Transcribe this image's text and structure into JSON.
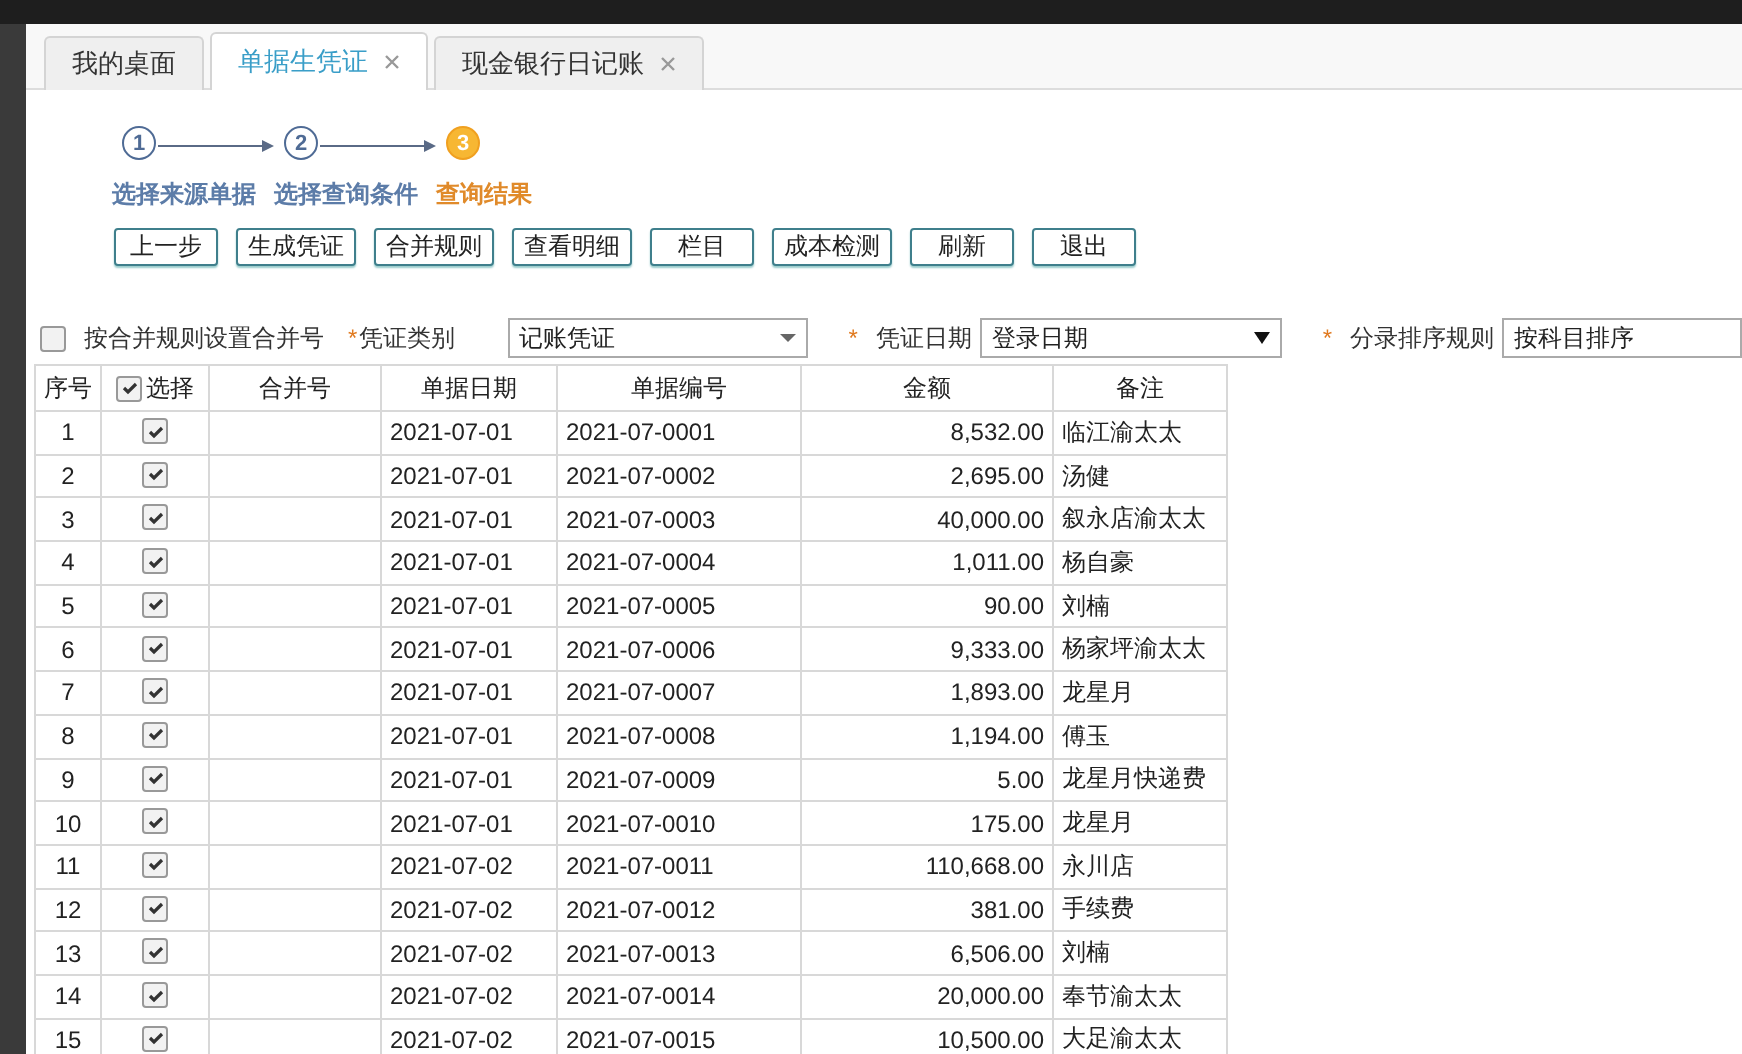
{
  "tabs": [
    {
      "label": "我的桌面",
      "selected": false,
      "closable": false
    },
    {
      "label": "单据生凭证",
      "selected": true,
      "closable": true
    },
    {
      "label": "现金银行日记账",
      "selected": false,
      "closable": true
    }
  ],
  "steps": [
    {
      "number": "1",
      "label": "选择来源单据",
      "current": false
    },
    {
      "number": "2",
      "label": "选择查询条件",
      "current": false
    },
    {
      "number": "3",
      "label": "查询结果",
      "current": true
    }
  ],
  "buttons": [
    "上一步",
    "生成凭证",
    "合并规则",
    "查看明细",
    "栏目",
    "成本检测",
    "刷新",
    "退出"
  ],
  "filters": {
    "merge_by_rule": {
      "label": "按合并规则设置合并号",
      "checked": false
    },
    "voucher_type": {
      "label": "凭证类别",
      "required_mark": "*",
      "value": "记账凭证"
    },
    "voucher_date": {
      "label": "凭证日期",
      "required_mark": "*",
      "value": "登录日期"
    },
    "entry_sort": {
      "label": "分录排序规则",
      "required_mark": "*",
      "value": "按科目排序"
    }
  },
  "table": {
    "columns": [
      "序号",
      "选择",
      "合并号",
      "单据日期",
      "单据编号",
      "金额",
      "备注"
    ],
    "select_all_checked": true,
    "rows": [
      {
        "no": "1",
        "checked": true,
        "merge_no": "",
        "date": "2021-07-01",
        "doc_no": "2021-07-0001",
        "amount": "8,532.00",
        "note": "临江渝太太"
      },
      {
        "no": "2",
        "checked": true,
        "merge_no": "",
        "date": "2021-07-01",
        "doc_no": "2021-07-0002",
        "amount": "2,695.00",
        "note": "汤健"
      },
      {
        "no": "3",
        "checked": true,
        "merge_no": "",
        "date": "2021-07-01",
        "doc_no": "2021-07-0003",
        "amount": "40,000.00",
        "note": "叙永店渝太太"
      },
      {
        "no": "4",
        "checked": true,
        "merge_no": "",
        "date": "2021-07-01",
        "doc_no": "2021-07-0004",
        "amount": "1,011.00",
        "note": "杨自豪"
      },
      {
        "no": "5",
        "checked": true,
        "merge_no": "",
        "date": "2021-07-01",
        "doc_no": "2021-07-0005",
        "amount": "90.00",
        "note": "刘楠"
      },
      {
        "no": "6",
        "checked": true,
        "merge_no": "",
        "date": "2021-07-01",
        "doc_no": "2021-07-0006",
        "amount": "9,333.00",
        "note": "杨家坪渝太太"
      },
      {
        "no": "7",
        "checked": true,
        "merge_no": "",
        "date": "2021-07-01",
        "doc_no": "2021-07-0007",
        "amount": "1,893.00",
        "note": "龙星月"
      },
      {
        "no": "8",
        "checked": true,
        "merge_no": "",
        "date": "2021-07-01",
        "doc_no": "2021-07-0008",
        "amount": "1,194.00",
        "note": "傅玉"
      },
      {
        "no": "9",
        "checked": true,
        "merge_no": "",
        "date": "2021-07-01",
        "doc_no": "2021-07-0009",
        "amount": "5.00",
        "note": "龙星月快递费"
      },
      {
        "no": "10",
        "checked": true,
        "merge_no": "",
        "date": "2021-07-01",
        "doc_no": "2021-07-0010",
        "amount": "175.00",
        "note": "龙星月"
      },
      {
        "no": "11",
        "checked": true,
        "merge_no": "",
        "date": "2021-07-02",
        "doc_no": "2021-07-0011",
        "amount": "110,668.00",
        "note": "永川店"
      },
      {
        "no": "12",
        "checked": true,
        "merge_no": "",
        "date": "2021-07-02",
        "doc_no": "2021-07-0012",
        "amount": "381.00",
        "note": "手续费"
      },
      {
        "no": "13",
        "checked": true,
        "merge_no": "",
        "date": "2021-07-02",
        "doc_no": "2021-07-0013",
        "amount": "6,506.00",
        "note": "刘楠"
      },
      {
        "no": "14",
        "checked": true,
        "merge_no": "",
        "date": "2021-07-02",
        "doc_no": "2021-07-0014",
        "amount": "20,000.00",
        "note": "奉节渝太太"
      },
      {
        "no": "15",
        "checked": true,
        "merge_no": "",
        "date": "2021-07-02",
        "doc_no": "2021-07-0015",
        "amount": "10,500.00",
        "note": "大足渝太太"
      }
    ]
  }
}
